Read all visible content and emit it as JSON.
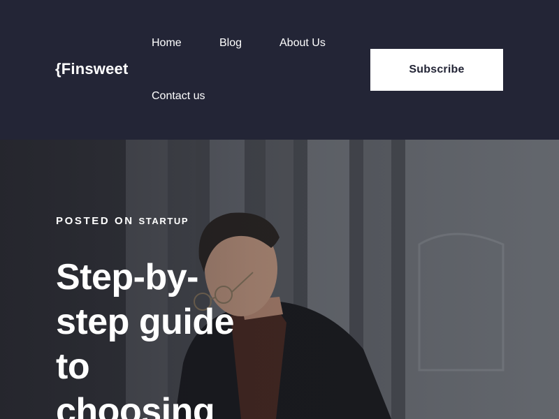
{
  "header": {
    "logo": "{Finsweet",
    "nav": {
      "home": "Home",
      "blog": "Blog",
      "about": "About Us",
      "contact": "Contact us"
    },
    "subscribe_label": "Subscribe"
  },
  "hero": {
    "posted_prefix": "POSTED ON",
    "category": "STARTUP",
    "title": "Step-by-step guide to choosing"
  },
  "colors": {
    "header_bg": "#232536",
    "text_light": "#ffffff",
    "button_bg": "#ffffff",
    "button_text": "#232536"
  }
}
